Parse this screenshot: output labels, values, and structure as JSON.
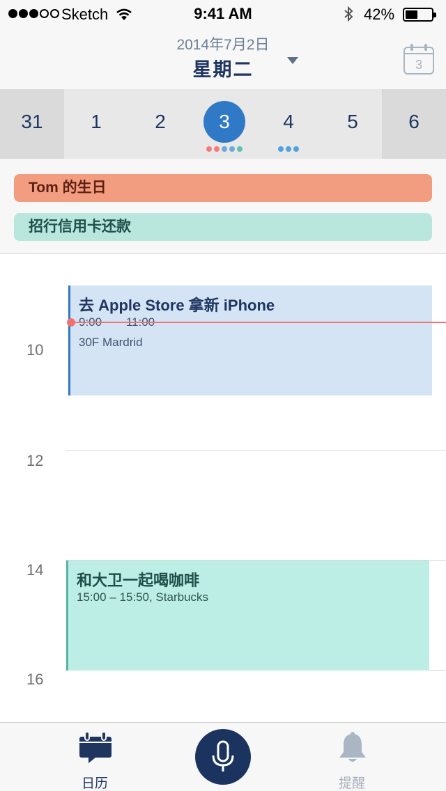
{
  "status_bar": {
    "carrier": "Sketch",
    "time": "9:41 AM",
    "battery": "42%",
    "signal_bars_filled": 3,
    "signal_bars_total": 5,
    "battery_level": 0.42
  },
  "header": {
    "date": "2014年7月2日",
    "weekday": "星期二",
    "calendar_button_day": "3"
  },
  "week": {
    "days": [
      {
        "label": "31",
        "muted": true
      },
      {
        "label": "1"
      },
      {
        "label": "2"
      },
      {
        "label": "3",
        "selected": true,
        "dots": [
          "#f47c7c",
          "#f47c7c",
          "#6fa9d8",
          "#6fa9d8",
          "#5cc2b2"
        ]
      },
      {
        "label": "4",
        "dots": [
          "#4fa3de",
          "#4fa3de",
          "#4fa3de"
        ]
      },
      {
        "label": "5"
      },
      {
        "label": "6",
        "muted": true
      }
    ]
  },
  "all_day": [
    {
      "title": "Tom 的生日",
      "color": "#f29c80"
    },
    {
      "title": "招行信用卡还款",
      "color": "#b9e7dd"
    }
  ],
  "hours": [
    "10",
    "12",
    "14",
    "16"
  ],
  "events": [
    {
      "title": "去 Apple Store 拿新 iPhone",
      "start": "9:00",
      "end": "11:00",
      "location": "30F Mardrid",
      "color": "#d4e4f5",
      "accent": "#2f79c6"
    },
    {
      "title": "和大卫一起喝咖啡",
      "detail": "15:00  –  15:50, Starbucks",
      "color": "#bdeee5",
      "accent": "#52b6a8"
    }
  ],
  "tabs": {
    "calendar": "日历",
    "reminders": "提醒"
  },
  "colors": {
    "primary": "#1e3560",
    "selected_day": "#2f79c6",
    "now_indicator": "#ef7373"
  }
}
